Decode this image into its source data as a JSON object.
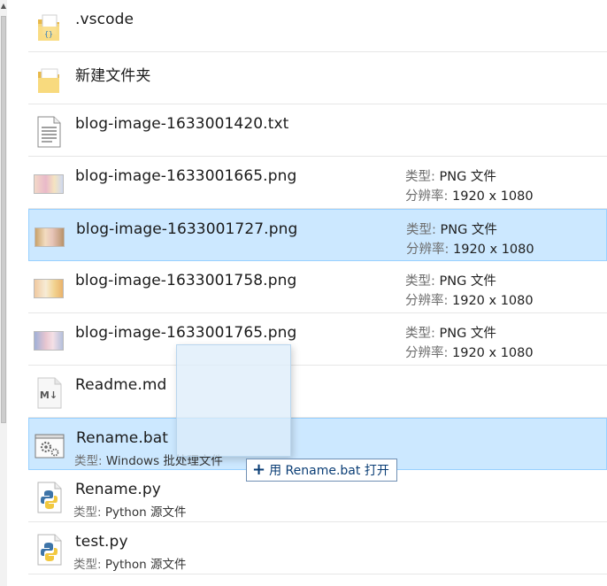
{
  "files": [
    {
      "name": ".vscode",
      "icon": "folder-vscode-icon"
    },
    {
      "name": "新建文件夹",
      "icon": "folder-icon"
    },
    {
      "name": "blog-image-1633001420.txt",
      "icon": "text-file-icon"
    },
    {
      "name": "blog-image-1633001665.png",
      "icon": "image-thumbnail",
      "type_label": "类型:",
      "type_value": "PNG 文件",
      "res_label": "分辨率:",
      "res_value": "1920 x 1080"
    },
    {
      "name": "blog-image-1633001727.png",
      "icon": "image-thumbnail",
      "selected": true,
      "type_label": "类型:",
      "type_value": "PNG 文件",
      "res_label": "分辨率:",
      "res_value": "1920 x 1080"
    },
    {
      "name": "blog-image-1633001758.png",
      "icon": "image-thumbnail",
      "type_label": "类型:",
      "type_value": "PNG 文件",
      "res_label": "分辨率:",
      "res_value": "1920 x 1080"
    },
    {
      "name": "blog-image-1633001765.png",
      "icon": "image-thumbnail",
      "type_label": "类型:",
      "type_value": "PNG 文件",
      "res_label": "分辨率:",
      "res_value": "1920 x 1080"
    },
    {
      "name": "Readme.md",
      "icon": "markdown-file-icon"
    },
    {
      "name": "Rename.bat",
      "icon": "batch-file-icon",
      "selected": true,
      "sub_label": "类型:",
      "sub_value": "Windows 批处理文件"
    },
    {
      "name": "Rename.py",
      "icon": "python-file-icon",
      "sub_label": "类型:",
      "sub_value": "Python 源文件"
    },
    {
      "name": "test.py",
      "icon": "python-file-icon",
      "sub_label": "类型:",
      "sub_value": "Python 源文件"
    }
  ],
  "drop_tooltip": {
    "plus": "+",
    "text": "用 Rename.bat 打开"
  },
  "colors": {
    "selected_bg": "#cce8ff",
    "selected_border": "#99d1ff",
    "folder": "#f4cf6a"
  }
}
